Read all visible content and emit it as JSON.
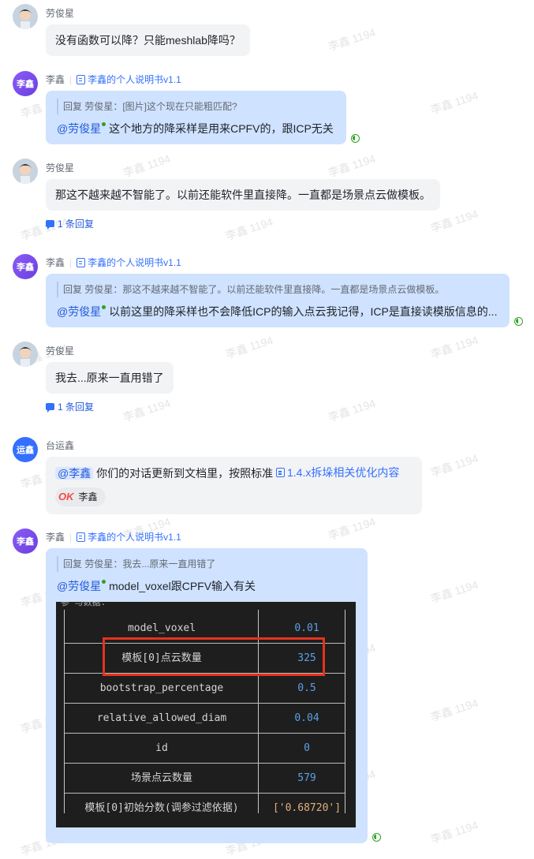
{
  "watermark": "李鑫 1194",
  "colors": {
    "accent": "#3370ff",
    "reply_bubble": "#cfe2ff",
    "gray_bubble": "#f2f3f5",
    "highlight_box": "#e5321e",
    "online": "#2ea121"
  },
  "messages": [
    {
      "sender": "劳俊星",
      "avatar_icon": "user-photo-avatar",
      "text": "没有函数可以降？只能meshlab降吗？"
    },
    {
      "sender": "李鑫",
      "avatar_text": "李鑫",
      "doc_title": "李鑫的个人说明书v1.1",
      "quote": "回复 劳俊星：[图片]这个现在只能粗匹配?",
      "mention": "@劳俊星",
      "text": "这个地方的降采样是用来CPFV的，跟ICP无关"
    },
    {
      "sender": "劳俊星",
      "avatar_icon": "user-photo-avatar",
      "text": "那这不越来越不智能了。以前还能软件里直接降。一直都是场景点云做模板。",
      "reply_count": "1 条回复"
    },
    {
      "sender": "李鑫",
      "avatar_text": "李鑫",
      "doc_title": "李鑫的个人说明书v1.1",
      "quote": "回复 劳俊星：那这不越来越不智能了。以前还能软件里直接降。一直都是场景点云做模板。",
      "mention": "@劳俊星",
      "text": "以前这里的降采样也不会降低ICP的输入点云我记得，ICP是直接读模版信息的..."
    },
    {
      "sender": "劳俊星",
      "avatar_icon": "user-photo-avatar",
      "text": "我去...原来一直用错了",
      "reply_count": "1 条回复"
    },
    {
      "sender": "台运鑫",
      "avatar_text": "运鑫",
      "mention": "@李鑫",
      "text": "你们的对话更新到文档里，按照标准",
      "doc_link": "1.4.x拆垛相关优化内容",
      "reaction_logo": "OK",
      "reaction_user": "李鑫"
    },
    {
      "sender": "李鑫",
      "avatar_text": "李鑫",
      "doc_title": "李鑫的个人说明书v1.1",
      "quote": "回复 劳俊星：我去...原来一直用错了",
      "mention": "@劳俊星",
      "text": "model_voxel跟CPFV输入有关"
    }
  ],
  "terminal": {
    "header_fragment": "参  与数据:",
    "rows": [
      {
        "key": "model_voxel",
        "value": "0.01"
      },
      {
        "key": "模板[0]点云数量",
        "value": "325"
      },
      {
        "key": "bootstrap_percentage",
        "value": "0.5"
      },
      {
        "key": "relative_allowed_diam",
        "value": "0.04"
      },
      {
        "key": "id",
        "value": "0"
      },
      {
        "key": "场景点云数量",
        "value": "579"
      },
      {
        "key": "模板[0]初始分数(调参过滤依据)",
        "value": "['0.68720']"
      }
    ]
  }
}
